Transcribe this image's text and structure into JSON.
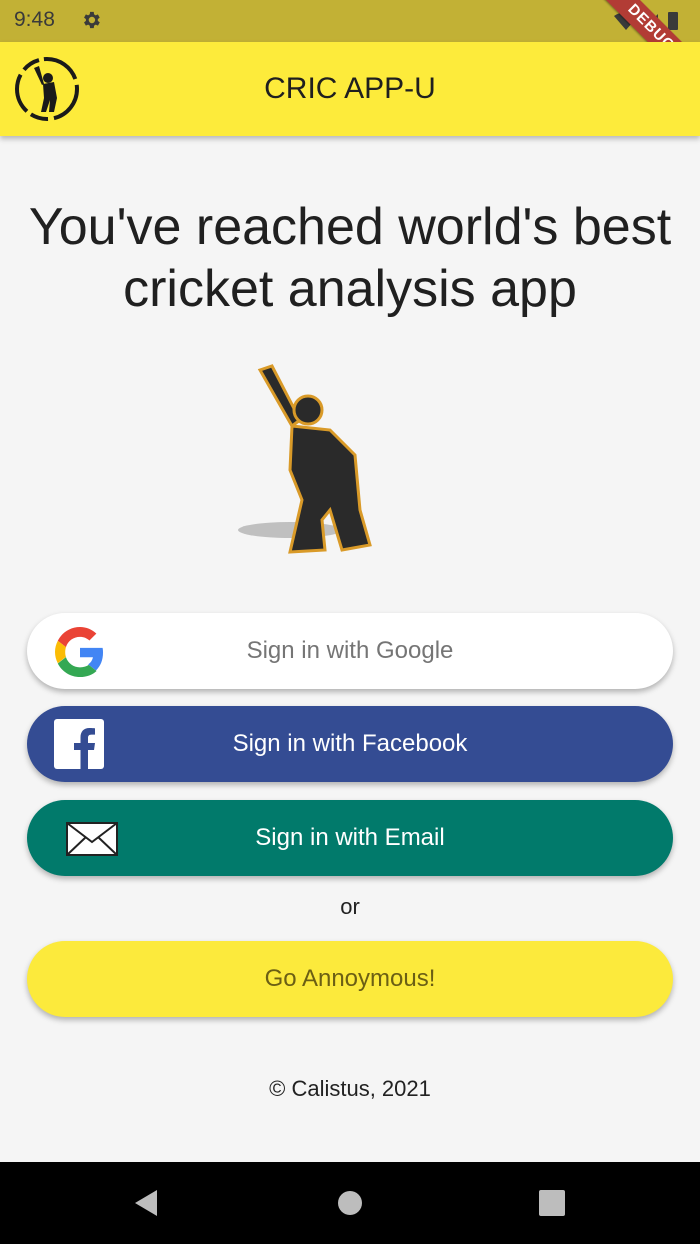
{
  "status_bar": {
    "time": "9:48",
    "debug_label": "DEBUG",
    "icons": [
      "gear-icon",
      "wifi-icon",
      "signal-icon",
      "battery-icon"
    ]
  },
  "app_bar": {
    "title": "CRIC APP-U",
    "background": "#fdeb3b"
  },
  "hero": {
    "title": "You've reached world's best cricket analysis app"
  },
  "buttons": {
    "google": {
      "label": "Sign in with Google",
      "background": "#ffffff"
    },
    "facebook": {
      "label": "Sign in with Facebook",
      "background": "#344c93"
    },
    "email": {
      "label": "Sign in with Email",
      "background": "#017a6b"
    },
    "anonymous": {
      "label": "Go Annoymous!",
      "background": "#fcea3c"
    }
  },
  "separator": {
    "text": "or"
  },
  "footer": {
    "copyright": "© Calistus, 2021"
  },
  "nav": {
    "icons": [
      "back-icon",
      "home-icon",
      "recents-icon"
    ]
  }
}
